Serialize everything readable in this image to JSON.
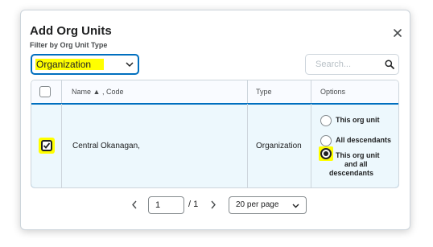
{
  "dialog": {
    "title": "Add Org Units",
    "close_icon": "close-icon"
  },
  "filter": {
    "label": "Filter by Org Unit Type",
    "selected": "Organization",
    "chevron_icon": "chevron-down-icon"
  },
  "search": {
    "placeholder": "Search...",
    "value": "",
    "icon": "search-icon"
  },
  "table": {
    "headers": {
      "name": "Name",
      "sort_indicator": "▲",
      "code": ", Code",
      "type": "Type",
      "options": "Options"
    },
    "rows": [
      {
        "checked": true,
        "name": "Central Okanagan,",
        "type": "Organization",
        "options": [
          {
            "label": "This org unit",
            "selected": false
          },
          {
            "label": "All descendants",
            "selected": false
          },
          {
            "label_lines": [
              "This org unit",
              "and all",
              "descendants"
            ],
            "selected": true
          }
        ]
      }
    ]
  },
  "pagination": {
    "prev_icon": "chevron-left-icon",
    "current_page": "1",
    "total": "/ 1",
    "next_icon": "chevron-right-icon",
    "per_page": "20 per page",
    "per_page_chevron_icon": "chevron-down-icon"
  },
  "colors": {
    "highlight": "#ffff00",
    "focus_blue": "#006fbf",
    "row_selected_bg": "#edf8fd",
    "header_bg": "#f9fbff",
    "border": "#cdd5dc"
  }
}
